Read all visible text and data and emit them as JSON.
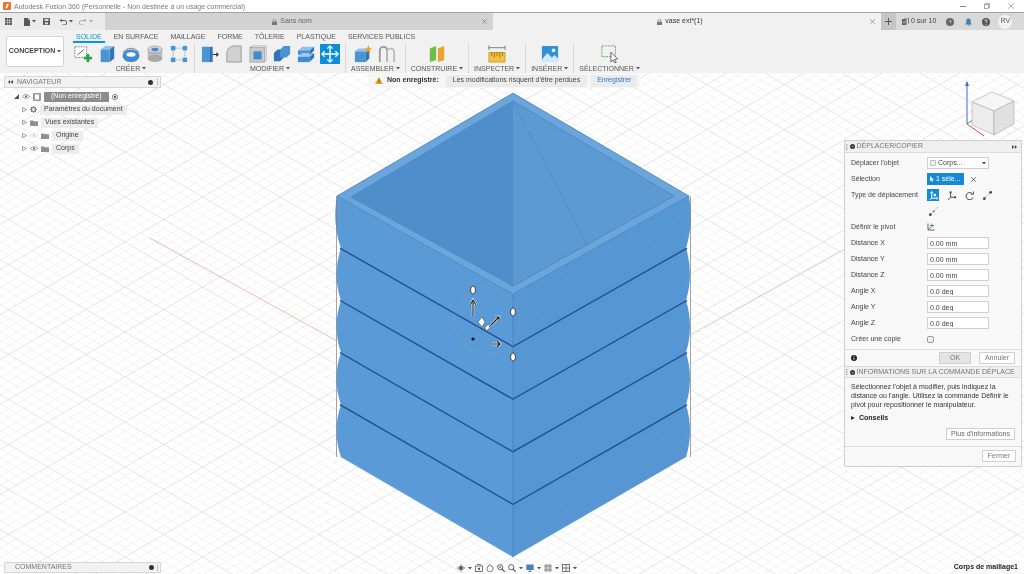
{
  "title_bar": {
    "title": "Autodesk Fusion 360 (Personnelle - Non destinée à un usage commercial)"
  },
  "document_tabs": [
    {
      "label": "Sans nom",
      "selected": false
    },
    {
      "label": "vase ext*(1)",
      "selected": true
    }
  ],
  "job_status": "0 sur 10",
  "user_initials": "RV",
  "workspace": "CONCEPTION",
  "toolbar_tabs": [
    {
      "label": "SOLIDE",
      "selected": true
    },
    {
      "label": "EN SURFACE",
      "selected": false
    },
    {
      "label": "MAILLAGE",
      "selected": false
    },
    {
      "label": "FORME",
      "selected": false
    },
    {
      "label": "TÔLERIE",
      "selected": false
    },
    {
      "label": "PLASTIQUE",
      "selected": false
    },
    {
      "label": "SERVICES PUBLICS",
      "selected": false
    }
  ],
  "tool_groups": [
    {
      "label": "CRÉER",
      "tools": [
        {
          "selected": false
        },
        {
          "selected": false
        },
        {
          "selected": false
        },
        {
          "selected": false
        },
        {
          "selected": false
        }
      ]
    },
    {
      "label": "MODIFIER",
      "tools": [
        {
          "selected": false
        },
        {
          "selected": false
        },
        {
          "selected": false
        },
        {
          "selected": false
        },
        {
          "selected": false
        },
        {
          "selected": true
        }
      ]
    },
    {
      "label": "ASSEMBLER",
      "tools": [
        {
          "selected": false
        },
        {
          "selected": false
        }
      ]
    },
    {
      "label": "CONSTRUIRE",
      "tools": [
        {
          "selected": false
        }
      ]
    },
    {
      "label": "INSPECTER",
      "tools": [
        {
          "selected": false
        }
      ]
    },
    {
      "label": "INSÉRER",
      "tools": [
        {
          "selected": false
        }
      ]
    },
    {
      "label": "SÉLECTIONNER",
      "tools": [
        {
          "selected": false
        }
      ]
    }
  ],
  "notification": {
    "title": "Non enregistré:",
    "message": "Les modifications risquent d'être perdues",
    "action": "Enregistrer"
  },
  "navigator": {
    "title": "NAVIGATEUR",
    "items": [
      {
        "label": "(Non enregistré)",
        "kind": "document",
        "expanded": true,
        "visible": true,
        "selected": true,
        "children": [
          {
            "label": "Paramètres du document",
            "kind": "settings",
            "expanded": false,
            "selected": false
          },
          {
            "label": "Vues existantes",
            "kind": "folder",
            "expanded": false,
            "selected": false
          },
          {
            "label": "Origine",
            "kind": "folder",
            "expanded": false,
            "visible": false,
            "selected": false
          },
          {
            "label": "Corps",
            "kind": "folder",
            "expanded": false,
            "visible": true,
            "selected": false
          }
        ]
      }
    ]
  },
  "move_panel": {
    "title": "DÉPLACER/COPIER",
    "rows": [
      {
        "kind": "dropdown",
        "label": "Déplacer l'objet",
        "value": "Corps..."
      },
      {
        "kind": "selection",
        "label": "Sélection",
        "value": "1 séle..."
      },
      {
        "kind": "move_types",
        "label": "Type de déplacement",
        "options": [
          {
            "selected": true
          },
          {
            "selected": false
          },
          {
            "selected": false
          },
          {
            "selected": false
          },
          {
            "selected": false
          }
        ]
      },
      {
        "kind": "pivot",
        "label": "Définir le pivot"
      },
      {
        "kind": "number",
        "label": "Distance X",
        "value": "0.00 mm"
      },
      {
        "kind": "number",
        "label": "Distance Y",
        "value": "0.00 mm"
      },
      {
        "kind": "number",
        "label": "Distance Z",
        "value": "0.00 mm"
      },
      {
        "kind": "number",
        "label": "Angle X",
        "value": "0.0 deg"
      },
      {
        "kind": "number",
        "label": "Angle Y",
        "value": "0.0 deg"
      },
      {
        "kind": "number",
        "label": "Angle Z",
        "value": "0.0 deg"
      },
      {
        "kind": "checkbox",
        "label": "Créer une copie",
        "checked": false
      }
    ],
    "buttons": [
      {
        "label": "OK",
        "default": true
      },
      {
        "label": "Annuler",
        "default": false
      }
    ]
  },
  "info_panel": {
    "title": "INFORMATIONS SUR LA COMMANDE DÉPLACE",
    "text": "Sélectionnez l'objet à modifier, puis indiquez la distance ou l'angle. Utilisez la commande Définir le pivot pour repositionner le manipulateur.",
    "tips": {
      "label": "Conseils",
      "expanded": false
    },
    "more_button": "Plus d'informations",
    "close_button": "Fermer"
  },
  "comments_panel": {
    "title": "COMMENTAIRES"
  },
  "status_bar": {
    "selection": "Corps de maillage1"
  }
}
